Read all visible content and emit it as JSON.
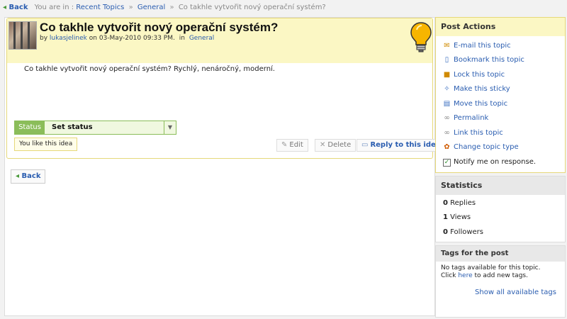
{
  "breadcrumb": {
    "back_label": "Back",
    "you_are_in": "You are in :",
    "items": [
      "Recent Topics",
      "General",
      "Co takhle vytvořit nový operační systém?"
    ],
    "separator": "»"
  },
  "post": {
    "title": "Co takhle vytvořit nový operační systém?",
    "by": "by",
    "author": "lukasjelinek",
    "date": "on 03-May-2010 09:33 PM.",
    "in": "in",
    "category": "General",
    "body": "Co takhle vytvořit nový operační systém? Rychlý, nenáročný, moderní.",
    "status_label": "Status",
    "status_value": "Set status",
    "like_text": "You like this idea",
    "edit_label": "Edit",
    "delete_label": "Delete",
    "reply_label": "Reply to this idea",
    "icon": "lightbulb-icon"
  },
  "back_button": "Back",
  "post_actions": {
    "title": "Post Actions",
    "items": [
      {
        "label": "E-mail this topic",
        "icon": "email-icon"
      },
      {
        "label": "Bookmark this topic",
        "icon": "bookmark-icon"
      },
      {
        "label": "Lock this topic",
        "icon": "lock-icon"
      },
      {
        "label": "Make this sticky",
        "icon": "pin-icon"
      },
      {
        "label": "Move this topic",
        "icon": "move-icon"
      },
      {
        "label": "Permalink",
        "icon": "link-icon"
      },
      {
        "label": "Link this topic",
        "icon": "chain-icon"
      },
      {
        "label": "Change topic type",
        "icon": "topic-type-icon"
      },
      {
        "label": "Notify me on response.",
        "icon": "checkbox-icon"
      }
    ]
  },
  "statistics": {
    "title": "Statistics",
    "replies_count": "0",
    "replies_label": "Replies",
    "views_count": "1",
    "views_label": "Views",
    "followers_count": "0",
    "followers_label": "Followers"
  },
  "tags": {
    "title": "Tags for the post",
    "none_text": "No tags available for this topic.",
    "click": "Click",
    "here": "here",
    "to_add": "to add new tags.",
    "all_tags": "Show all available tags"
  },
  "colors": {
    "accent": "#2a5db0",
    "status_green": "#8bbd5a",
    "post_header_bg": "#fbf7c4"
  }
}
